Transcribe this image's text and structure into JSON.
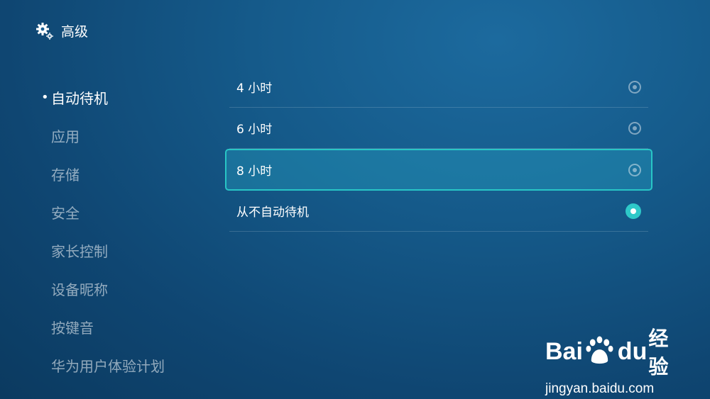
{
  "header": {
    "title": "高级",
    "icon": "gear-icon"
  },
  "sidebar": {
    "bullet": "•",
    "items": [
      {
        "label": "自动待机"
      },
      {
        "label": "应用"
      },
      {
        "label": "存储"
      },
      {
        "label": "安全"
      },
      {
        "label": "家长控制"
      },
      {
        "label": "设备昵称"
      },
      {
        "label": "按键音"
      },
      {
        "label": "华为用户体验计划"
      }
    ]
  },
  "options": [
    {
      "label": "4 小时"
    },
    {
      "label": "6 小时"
    },
    {
      "label": "8 小时"
    },
    {
      "label": "从不自动待机"
    }
  ],
  "watermark": {
    "brand_left": "Bai",
    "brand_right": "du",
    "product": "经验",
    "url": "jingyan.baidu.com"
  },
  "colors": {
    "accent": "#2ec9c9",
    "background": "#155a8a"
  }
}
